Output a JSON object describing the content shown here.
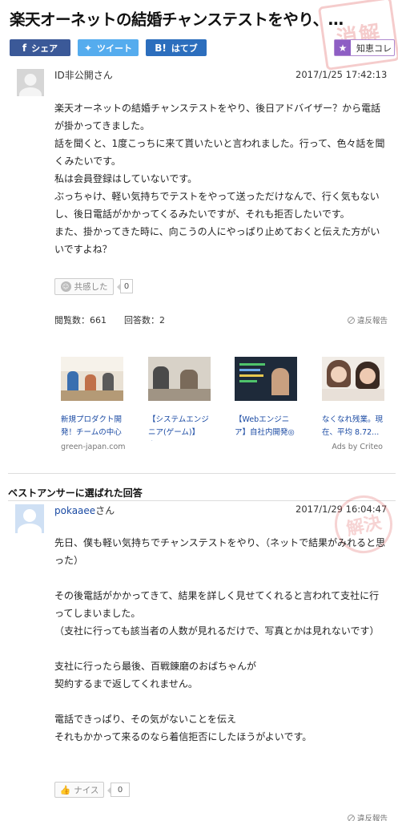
{
  "question": {
    "title": "楽天オーネットの結婚チャンステストをやり、…",
    "stamp_text": "消解",
    "share": {
      "facebook": "シェア",
      "twitter": "ツイート",
      "hatena": "はてブ",
      "hatena_glyph": "B!",
      "chiebukuro_collection": "知恵コレ"
    },
    "author": "ID非公開さん",
    "date": "2017/1/25 17:42:13",
    "body": [
      "楽天オーネットの結婚チャンステストをやり、後日アドバイザー？から電話が掛かってきました。",
      "話を聞くと、1度こっちに来て貰いたいと言われました。行って、色々話を聞くみたいです。",
      "私は会員登録はしていないです。",
      "ぶっちゃけ、軽い気持ちでテストをやって送っただけなんで、行く気もないし、後日電話がかかってくるみたいですが、それも拒否したいです。",
      "また、掛かってきた時に、向こうの人にやっぱり止めておくと伝えた方がいいですよね？"
    ],
    "empathy_label": "共感した",
    "empathy_count": "0",
    "views_label": "閲覧数：661",
    "answers_label": "回答数：2",
    "report_label": "違反報告"
  },
  "ads": {
    "items": [
      {
        "caption": "新規プロダクト開発！チームの中心"
      },
      {
        "caption": "【システムエンジニア(ゲーム)】未..."
      },
      {
        "caption": "【Webエンジニア】自社内開発◎テ..."
      },
      {
        "caption": "なくなれ残業。現在、平均 8.72..."
      }
    ],
    "source": "green-japan.com",
    "credit": "Ads by Criteo"
  },
  "best_answer": {
    "heading": "ベストアンサーに選ばれた回答",
    "author_link": "pokaaee",
    "author_suffix": "さん",
    "date": "2017/1/29 16:04:47",
    "stamp_text": "解決",
    "body": [
      "先日、僕も軽い気持ちでチャンステストをやり、（ネットで結果がみれると思った）",
      "",
      "その後電話がかかってきて、結果を詳しく見せてくれると言われて支社に行ってしまいました。",
      "（支社に行っても該当者の人数が見れるだけで、写真とかは見れないです）",
      "",
      "支社に行ったら最後、百戦錬磨のおばちゃんが",
      "契約するまで返してくれません。",
      "",
      "電話できっぱり、その気がないことを伝え",
      "それもかかって来るのなら着信拒否にしたほうがよいです。"
    ],
    "nice_label": "ナイス",
    "nice_count": "0",
    "report_label": "違反報告"
  }
}
